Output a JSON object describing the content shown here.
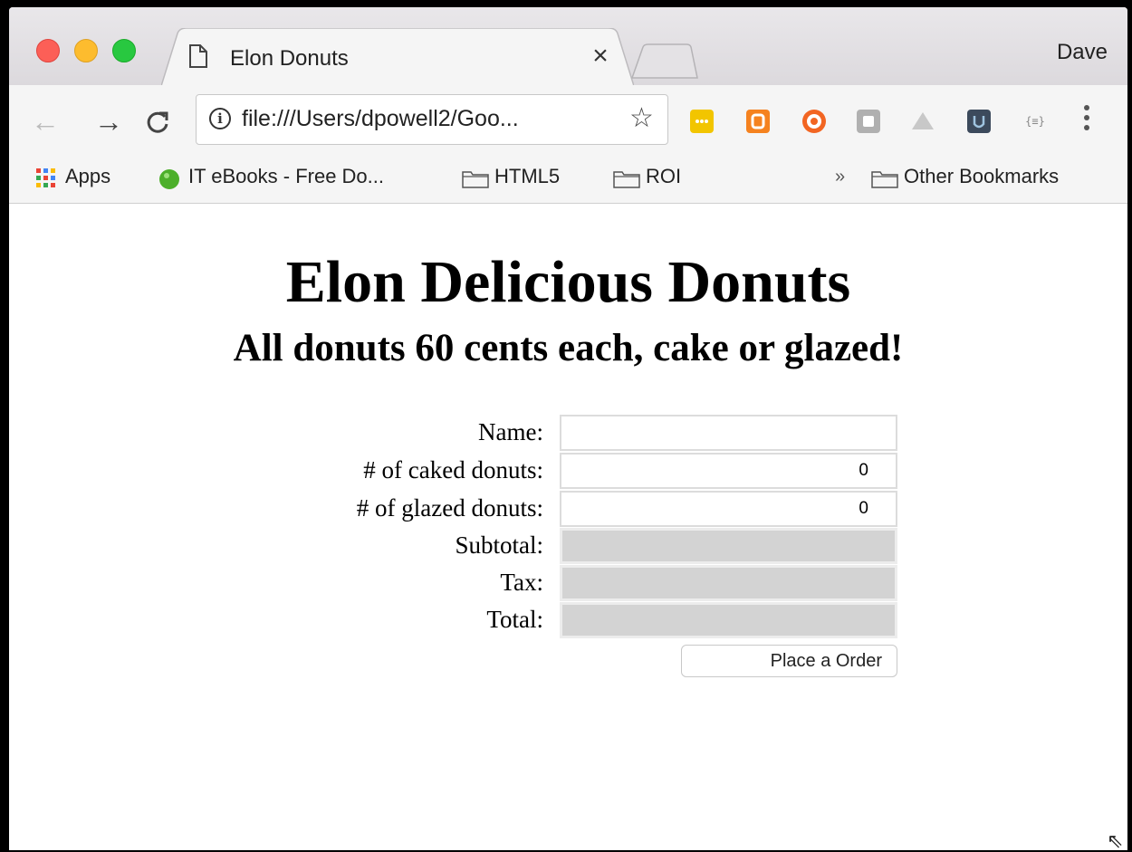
{
  "tab": {
    "title": "Elon Donuts",
    "close_glyph": "×",
    "doc_icon": "document-icon"
  },
  "profile_name": "Dave",
  "toolbar": {
    "back_glyph": "←",
    "forward_glyph": "→",
    "reload_glyph": "C",
    "url": "file:///Users/dpowell2/Goo...",
    "info_glyph": "i",
    "star_glyph": "☆"
  },
  "bookmarks": {
    "apps": "Apps",
    "items": [
      "IT eBooks - Free Do...",
      "HTML5",
      "ROI"
    ],
    "overflow_glyph": "»",
    "other": "Other Bookmarks"
  },
  "page": {
    "heading": "Elon Delicious Donuts",
    "subheading": "All donuts 60 cents each, cake or glazed!",
    "form": {
      "name_label": "Name:",
      "name_value": "",
      "caked_label": "# of caked donuts:",
      "caked_value": "0",
      "glazed_label": "# of glazed donuts:",
      "glazed_value": "0",
      "subtotal_label": "Subtotal:",
      "subtotal_value": "",
      "tax_label": "Tax:",
      "tax_value": "",
      "total_label": "Total:",
      "total_value": "",
      "submit_label": "Place a Order"
    }
  },
  "resize_glyph": "⇖",
  "colors": {
    "traffic_red": "#fc5f57",
    "traffic_yellow": "#fdbc2e",
    "traffic_green": "#28c840",
    "readonly_field": "#d3d3d3"
  }
}
